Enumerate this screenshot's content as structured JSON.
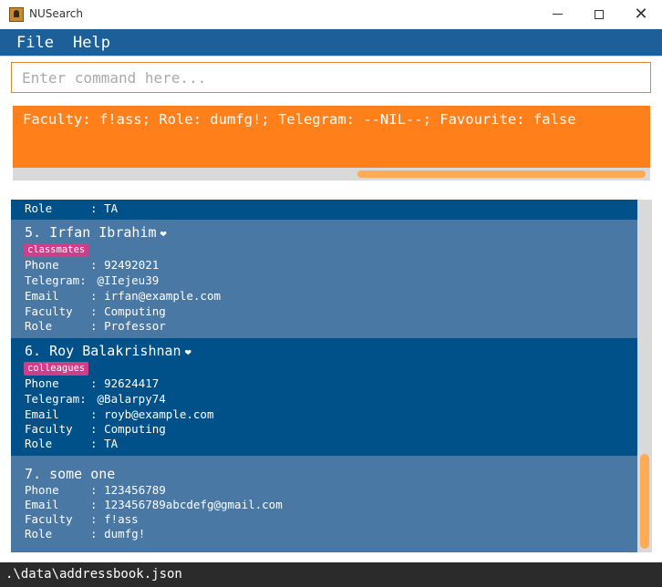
{
  "window": {
    "title": "NUSearch",
    "app_icon": "address-book-icon"
  },
  "menu": {
    "file": "File",
    "help": "Help"
  },
  "command": {
    "placeholder": "Enter command here...",
    "value": ""
  },
  "result": {
    "text": "Faculty: f!ass; Role: dumfg!; Telegram: --NIL--; Favourite: false"
  },
  "persons": [
    {
      "id": 4,
      "partial": true,
      "fields": [
        {
          "label": "Role",
          "value": "TA"
        }
      ]
    },
    {
      "index": "5.",
      "name": "Irfan Ibrahim",
      "favourite": "❤",
      "tag": "classmates",
      "fields": [
        {
          "label": "Phone",
          "value": "92492021"
        },
        {
          "label": "Telegram:",
          "value": "@IIejeu39"
        },
        {
          "label": "Email",
          "value": "irfan@example.com"
        },
        {
          "label": "Faculty",
          "value": "Computing"
        },
        {
          "label": "Role",
          "value": "Professor"
        }
      ]
    },
    {
      "index": "6.",
      "name": "Roy Balakrishnan",
      "favourite": "❤",
      "tag": "colleagues",
      "fields": [
        {
          "label": "Phone",
          "value": "92624417"
        },
        {
          "label": "Telegram:",
          "value": "@Balarpy74"
        },
        {
          "label": "Email",
          "value": "royb@example.com"
        },
        {
          "label": "Faculty",
          "value": "Computing"
        },
        {
          "label": "Role",
          "value": "TA"
        }
      ]
    },
    {
      "index": "7.",
      "name": "some one",
      "fields": [
        {
          "label": "Phone",
          "value": "123456789"
        },
        {
          "label": "Email",
          "value": "123456789abcdefg@gmail.com"
        },
        {
          "label": "Faculty",
          "value": "f!ass"
        },
        {
          "label": "Role",
          "value": "dumfg!"
        }
      ]
    }
  ],
  "status": {
    "path": ".\\data\\addressbook.json"
  },
  "colors": {
    "menu_bar": "#1d5f98",
    "result_bg": "#ff7f1a",
    "card_dark": "#005189",
    "card_light": "#4a78a4",
    "tag_bg": "#cc3f8a",
    "scroll_thumb": "#ffaa55",
    "status_bg": "#2b2b2b"
  }
}
